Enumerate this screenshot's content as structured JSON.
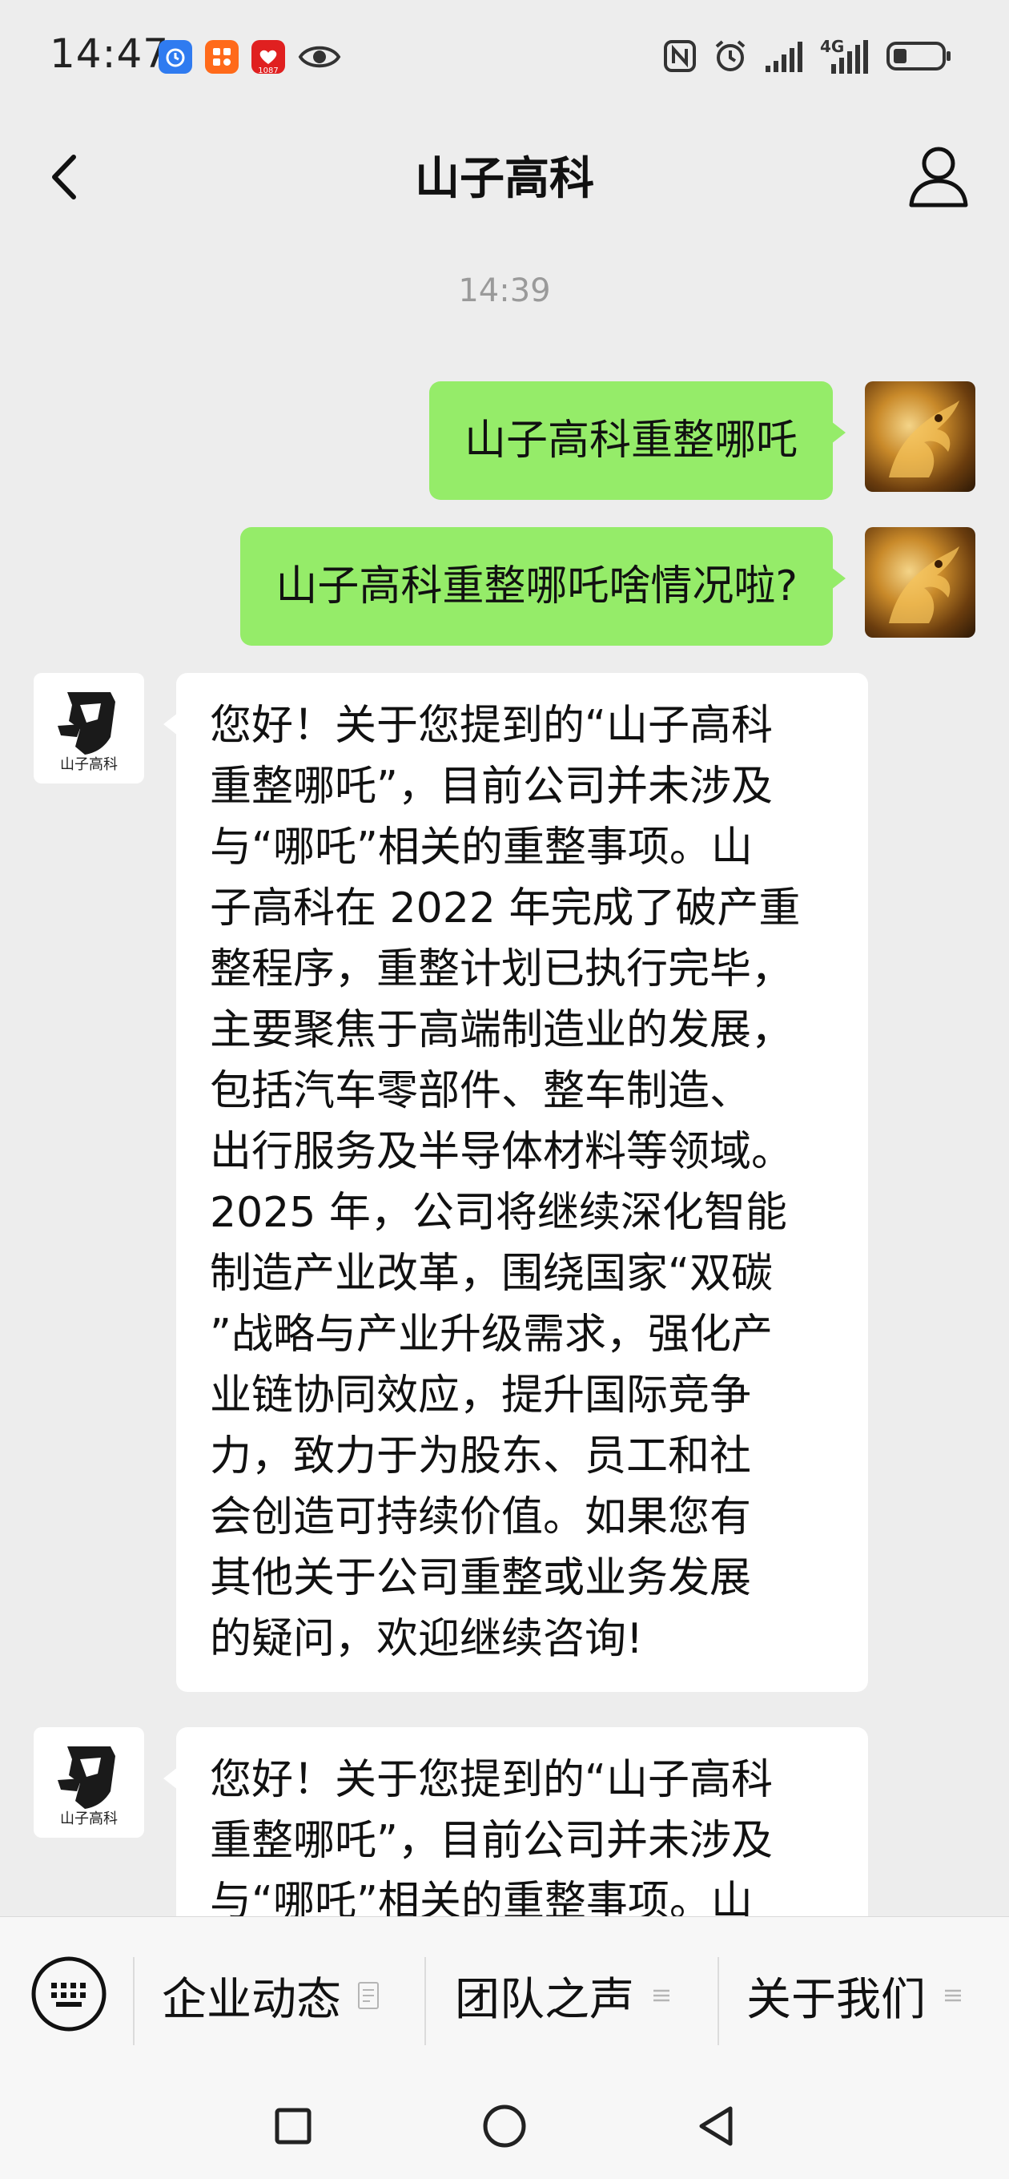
{
  "status_bar": {
    "time": "14:47",
    "app_icons": [
      "alarm-app-icon",
      "grid-app-icon",
      "pinduoduo-app-icon",
      "eye-icon"
    ],
    "pinduoduo_badge": "1087",
    "right_icons": [
      "nfc-icon",
      "alarm-clock-icon",
      "wifi-signal-icon",
      "4g-signal-icon",
      "battery-icon"
    ],
    "network_label": "4G"
  },
  "header": {
    "title": "山子高科",
    "back_icon": "chevron-left-icon",
    "profile_icon": "person-icon"
  },
  "chat": {
    "timestamp": "14:39",
    "messages": [
      {
        "direction": "out",
        "text": "山子高科重整哪吒"
      },
      {
        "direction": "out",
        "text": "山子高科重整哪吒啥情况啦?"
      },
      {
        "direction": "in",
        "lines": [
          "您好！关于您提到的“山子高科",
          "重整哪吒”，目前公司并未涉及",
          "与“哪吒”相关的重整事项。山",
          "子高科在 2022 年完成了破产重",
          "整程序，重整计划已执行完毕，",
          "主要聚焦于高端制造业的发展，",
          "包括汽车零部件、整车制造、",
          "出行服务及半导体材料等领域。",
          "2025 年，公司将继续深化智能",
          "制造产业改革，围绕国家“双碳",
          "”战略与产业升级需求，强化产",
          "业链协同效应，提升国际竞争",
          "力，致力于为股东、员工和社",
          "会创造可持续价值。如果您有",
          "其他关于公司重整或业务发展",
          "的疑问，欢迎继续咨询!"
        ]
      },
      {
        "direction": "in",
        "lines": [
          "您好！关于您提到的“山子高科",
          "重整哪吒”，目前公司并未涉及",
          "与“哪吒”相关的重整事项。山"
        ]
      }
    ],
    "logo_text": "山子高科"
  },
  "menu": {
    "keyboard_icon": "keyboard-icon",
    "items": [
      {
        "label": "企业动态",
        "icon": "document-icon"
      },
      {
        "label": "团队之声",
        "icon": "menu-lines-icon"
      },
      {
        "label": "关于我们",
        "icon": "menu-lines-icon"
      }
    ]
  },
  "nav": {
    "buttons": [
      "recent-apps-square-icon",
      "home-circle-icon",
      "back-triangle-icon"
    ]
  },
  "colors": {
    "background": "#ededed",
    "outgoing_bubble": "#95ec69",
    "incoming_bubble": "#ffffff",
    "timestamp_text": "#9a9a9a"
  }
}
